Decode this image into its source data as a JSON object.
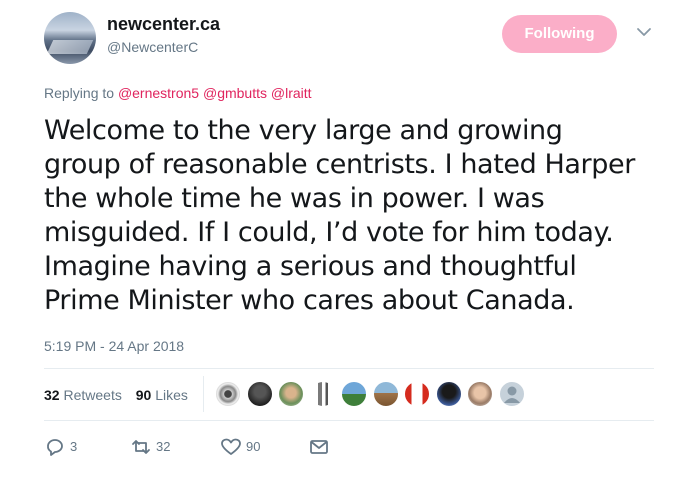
{
  "user": {
    "name": "newcenter.ca",
    "handle": "@NewcenterC",
    "follow_label": "Following"
  },
  "reply": {
    "prefix": "Replying to",
    "mentions": [
      "@ernestron5",
      "@gmbutts",
      "@lraitt"
    ]
  },
  "tweet": {
    "lines": [
      "Welcome to the very large and growing",
      "group of reasonable centrists. I hated Harper",
      "the whole time he was in power. I was",
      "misguided. If I could, I’d vote for him today.",
      "Imagine having a serious and thoughtful",
      "Prime Minister who cares about Canada."
    ],
    "timestamp": "5:19 PM - 24 Apr 2018"
  },
  "stats": {
    "retweets_count": "32",
    "retweets_label": "Retweets",
    "likes_count": "90",
    "likes_label": "Likes"
  },
  "actions": {
    "reply_count": "3",
    "retweet_count": "32",
    "like_count": "90"
  },
  "colors": {
    "follow_button": "#fbaec8",
    "mention": "#e0245e",
    "secondary_text": "#657786"
  },
  "icons": {
    "caret": "chevron-down-icon",
    "reply": "reply-icon",
    "retweet": "retweet-icon",
    "like": "heart-icon",
    "dm": "envelope-icon"
  }
}
